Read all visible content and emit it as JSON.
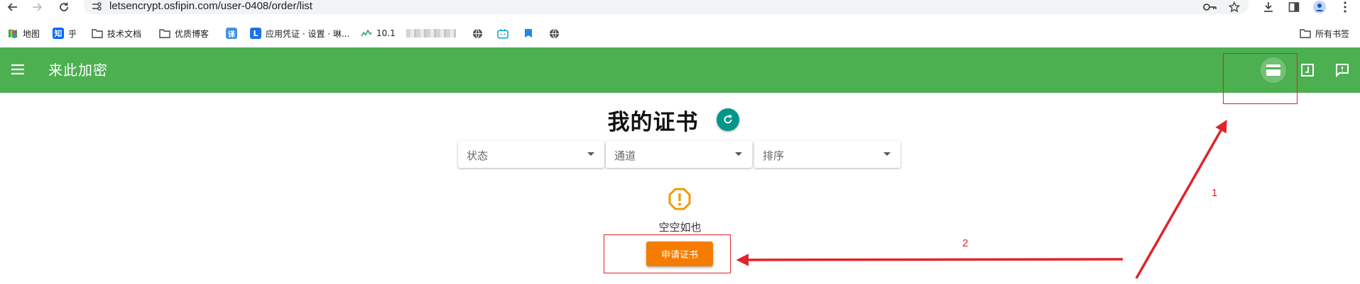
{
  "browser": {
    "url": "letsencrypt.osfipin.com/user-0408/order/list",
    "bookmarks": [
      {
        "label": "地图",
        "icon": "maps-icon"
      },
      {
        "label": "乎",
        "icon": "zhihu-icon"
      },
      {
        "label": "技术文档",
        "icon": "folder-icon"
      },
      {
        "label": "优质博客",
        "icon": "folder-icon"
      },
      {
        "label": "",
        "icon": "translate-icon"
      },
      {
        "label": "应用凭证 · 设置 · 琳...",
        "icon": "l-icon"
      },
      {
        "label": "10.1",
        "icon": "network-icon"
      },
      {
        "label": "",
        "icon": "globe-icon"
      },
      {
        "label": "",
        "icon": "bilibili-icon"
      },
      {
        "label": "",
        "icon": "bookmark-icon"
      },
      {
        "label": "",
        "icon": "globe-icon"
      }
    ],
    "all_bookmarks": "所有书签"
  },
  "app": {
    "title": "来此加密",
    "header_actions": [
      "card-icon",
      "login-icon",
      "feedback-icon"
    ]
  },
  "page": {
    "title": "我的证书",
    "filters": {
      "status": "状态",
      "channel": "通道",
      "sort": "排序"
    },
    "empty_text": "空空如也",
    "apply_button": "申请证书"
  },
  "annotations": {
    "step1": "1",
    "step2": "2"
  },
  "colors": {
    "appbar": "#4caf50",
    "refresh": "#009688",
    "apply": "#f57c00",
    "annotation": "#e0242b",
    "warning": "#f29900"
  }
}
